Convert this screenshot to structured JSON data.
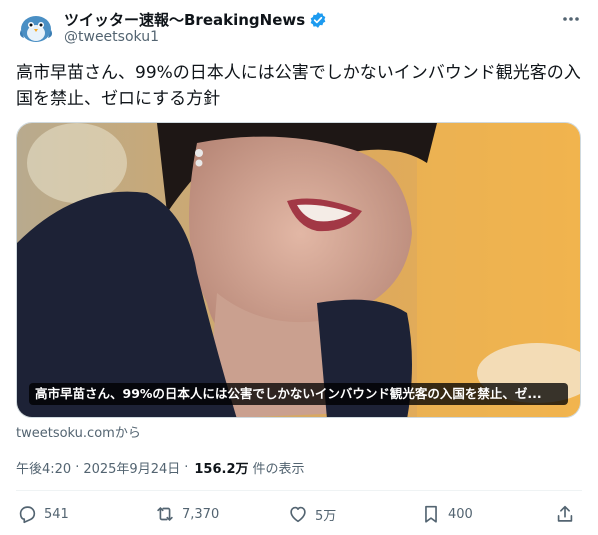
{
  "author": {
    "display_name": "ツイッター速報〜BreakingNews",
    "handle": "@tweetsoku1",
    "avatar_icon": "bird-mascot-icon",
    "verified_icon": "verified-badge-icon",
    "verified_color": "#1d9bf0"
  },
  "tweet": {
    "text": "高市早苗さん、99%の日本人には公害でしかないインバウンド観光客の入国を禁止、ゼロにする方針"
  },
  "media": {
    "caption": "高市早苗さん、99%の日本人には公害でしかないインバウンド観光客の入国を禁止、ゼ..."
  },
  "link": {
    "source_text": "tweetsoku.comから"
  },
  "meta": {
    "time": "午後4:20",
    "separator": "·",
    "date": "2025年9月24日",
    "views": "156.2万",
    "views_label": "件の表示"
  },
  "actions": {
    "reply_count": "541",
    "retweet_count": "7,370",
    "like_count": "5万",
    "bookmark_count": "400"
  },
  "colors": {
    "text_primary": "#0f1419",
    "text_secondary": "#536471",
    "accent": "#1d9bf0",
    "border": "#cfd9de"
  }
}
